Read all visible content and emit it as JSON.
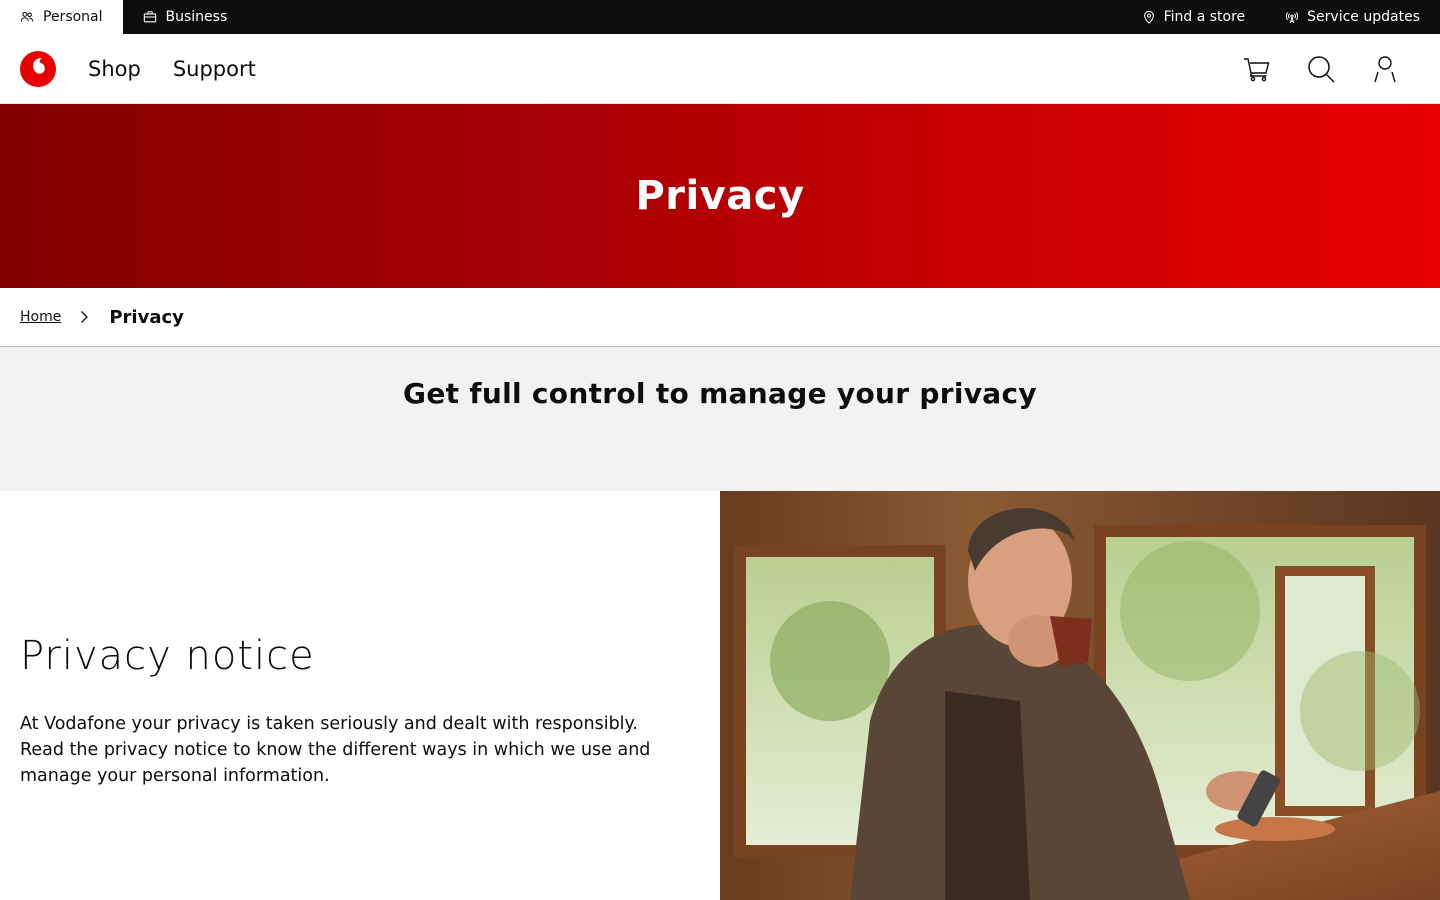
{
  "topbar": {
    "segments": [
      {
        "label": "Personal",
        "icon": "people-icon",
        "active": true
      },
      {
        "label": "Business",
        "icon": "briefcase-icon",
        "active": false
      }
    ],
    "utilities": [
      {
        "label": "Find a store",
        "icon": "location-pin-icon"
      },
      {
        "label": "Service updates",
        "icon": "signal-tower-icon"
      }
    ]
  },
  "nav": {
    "logo": "vodafone-logo",
    "links": [
      "Shop",
      "Support"
    ],
    "icons": [
      "cart-icon",
      "search-icon",
      "account-icon"
    ]
  },
  "hero": {
    "title": "Privacy"
  },
  "breadcrumb": {
    "home": "Home",
    "current": "Privacy"
  },
  "intro": {
    "heading": "Get full control to manage your privacy"
  },
  "content": {
    "heading": "Privacy notice",
    "body": "At Vodafone your privacy is taken seriously and dealt with responsibly. Read the privacy notice to know the different ways in which we use and manage your personal information."
  },
  "colors": {
    "brand_red": "#e60000",
    "dark": "#0d0d0d",
    "band_grey": "#f2f2f2"
  }
}
